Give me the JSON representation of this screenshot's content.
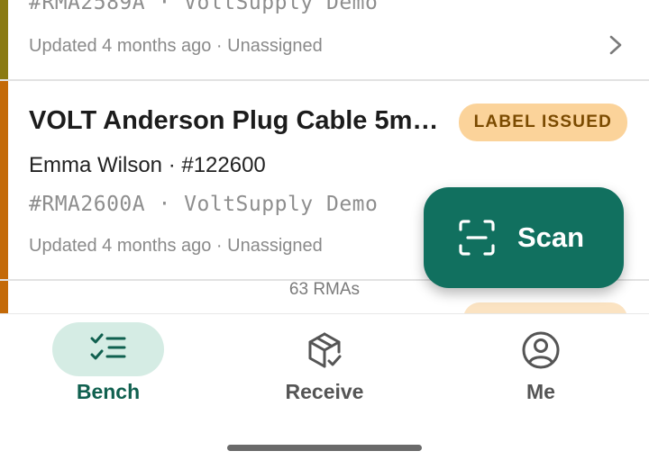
{
  "list": {
    "items": [
      {
        "ref": "#RMA2589A · VoltSupply Demo",
        "meta": "Updated 4 months ago · Unassigned"
      },
      {
        "title": "VOLT Anderson Plug Cable 5m…",
        "customer": "Emma Wilson · #122600",
        "ref": "#RMA2600A · VoltSupply Demo",
        "meta": "Updated 4 months ago · Unassigned",
        "badge": "LABEL ISSUED"
      }
    ],
    "count_label": "63 RMAs"
  },
  "fab": {
    "label": "Scan",
    "icon": "scan-icon"
  },
  "nav": {
    "tabs": [
      {
        "label": "Bench",
        "icon": "checklist-icon",
        "active": true
      },
      {
        "label": "Receive",
        "icon": "package-check-icon",
        "active": false
      },
      {
        "label": "Me",
        "icon": "account-circle-icon",
        "active": false
      }
    ]
  },
  "colors": {
    "accent": "#11705f",
    "active_pill": "#d5ece4",
    "badge_bg": "#fbd39a",
    "badge_text": "#7a4a00",
    "stripe_olive": "#8a7a12",
    "stripe_orange": "#c46a08"
  }
}
